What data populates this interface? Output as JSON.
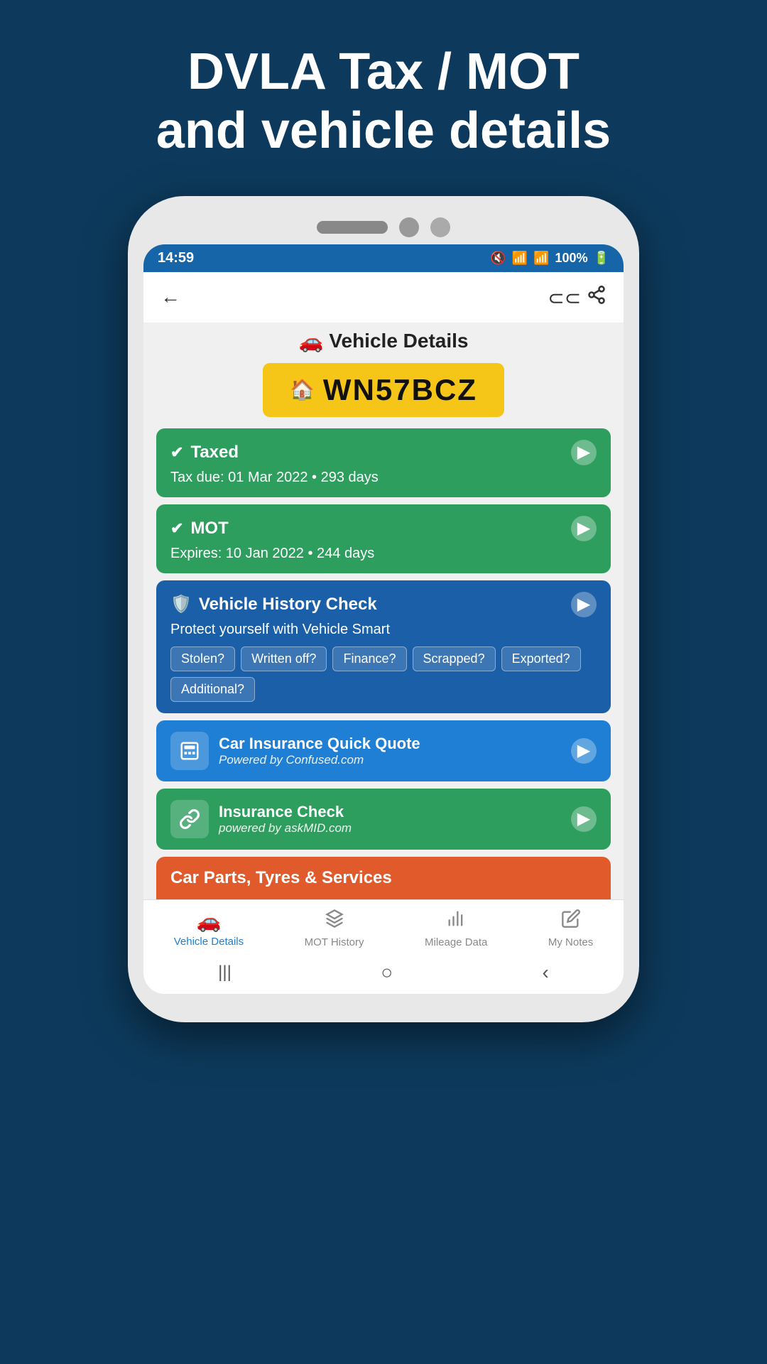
{
  "header": {
    "line1": "DVLA Tax / MOT",
    "line2": "and vehicle details"
  },
  "status_bar": {
    "time": "14:59",
    "battery": "100%",
    "signal_icons": "🔇 📶 📶 🔋"
  },
  "app": {
    "title": "Vehicle Details",
    "title_icon": "🚗",
    "plate": "WN57BCZ",
    "plate_icon": "🏠"
  },
  "taxed_card": {
    "title": "Taxed",
    "subtitle": "Tax due: 01 Mar 2022 • 293 days"
  },
  "mot_card": {
    "title": "MOT",
    "subtitle": "Expires: 10 Jan 2022 • 244 days"
  },
  "history_card": {
    "title": "Vehicle History Check",
    "subtitle": "Protect yourself with Vehicle Smart",
    "badges": [
      "Stolen?",
      "Written off?",
      "Finance?",
      "Scrapped?",
      "Exported?",
      "Additional?"
    ]
  },
  "insurance_quote_card": {
    "title": "Car Insurance Quick Quote",
    "subtitle": "Powered by  Confused.com"
  },
  "insurance_check_card": {
    "title": "Insurance Check",
    "subtitle": "powered by askMID.com"
  },
  "parts_card": {
    "title": "Car Parts, Tyres & Services"
  },
  "bottom_nav": {
    "items": [
      {
        "label": "Vehicle Details",
        "active": true
      },
      {
        "label": "MOT History",
        "active": false
      },
      {
        "label": "Mileage Data",
        "active": false
      },
      {
        "label": "My Notes",
        "active": false
      }
    ]
  },
  "gestures": {
    "back": "‹",
    "home": "○",
    "recent": "|||"
  }
}
